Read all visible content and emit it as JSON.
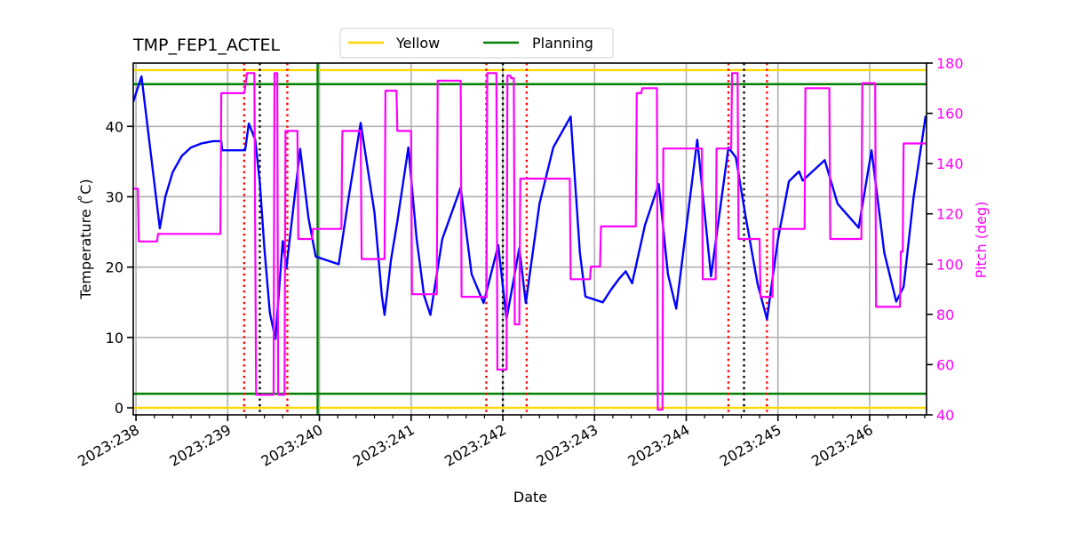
{
  "chart_data": {
    "type": "line",
    "title": "TMP_FEP1_ACTEL",
    "xlabel": "Date",
    "ylabel": "Temperature ($^\\circ$C)",
    "ylabel_display": "Temperature ( ̊C)",
    "y2label": "Pitch (deg)",
    "xlim": [
      237.97,
      246.62
    ],
    "ylim": [
      -1,
      49
    ],
    "y2lim": [
      40,
      180
    ],
    "grid": true,
    "legend_position": "top-center, above plot",
    "x_ticks": [
      238,
      239,
      240,
      241,
      242,
      243,
      244,
      245,
      246
    ],
    "x_tick_labels": [
      "2023:238",
      "2023:239",
      "2023:240",
      "2023:241",
      "2023:242",
      "2023:243",
      "2023:244",
      "2023:245",
      "2023:246"
    ],
    "x_minor_step": 0.2,
    "y_ticks": [
      0,
      10,
      20,
      30,
      40
    ],
    "y2_ticks": [
      40,
      60,
      80,
      100,
      120,
      140,
      160,
      180
    ],
    "colors": {
      "temperature": "#0000ff",
      "pitch": "#ff00ff",
      "yellow_limit": "#ffd700",
      "planning_limit": "#008000",
      "grid": "#b0b0b0",
      "comm_marker": "#ff0000",
      "pass_marker": "#000000",
      "pitch_axis": "#ff00ff"
    },
    "legend": [
      {
        "label": "Yellow",
        "color": "#ffd700"
      },
      {
        "label": "Planning",
        "color": "#008000"
      }
    ],
    "limits": {
      "yellow": [
        0,
        48
      ],
      "planning": [
        2,
        46
      ]
    },
    "vertical_lines": {
      "planning_start": 239.98,
      "red_dotted": [
        239.18,
        239.65,
        241.82,
        242.26,
        244.46,
        244.88
      ],
      "black_dotted": [
        239.35,
        242.0,
        244.63
      ]
    },
    "series": [
      {
        "name": "Temperature",
        "axis": "left",
        "x": [
          237.97,
          238.06,
          238.26,
          238.32,
          238.4,
          238.5,
          238.6,
          238.72,
          238.84,
          238.93,
          238.94,
          239.19,
          239.23,
          239.3,
          239.35,
          239.4,
          239.46,
          239.52,
          239.6,
          239.64,
          239.79,
          239.88,
          239.96,
          240.21,
          240.32,
          240.45,
          240.6,
          240.68,
          240.71,
          240.78,
          240.85,
          240.97,
          241.06,
          241.14,
          241.21,
          241.34,
          241.54,
          241.66,
          241.79,
          241.95,
          242.04,
          242.18,
          242.25,
          242.4,
          242.55,
          242.74,
          242.84,
          242.9,
          243.09,
          243.18,
          243.27,
          243.34,
          243.41,
          243.55,
          243.7,
          243.8,
          243.89,
          244.12,
          244.27,
          244.46,
          244.54,
          244.65,
          244.78,
          244.88,
          245.0,
          245.12,
          245.23,
          245.27,
          245.51,
          245.65,
          245.88,
          246.02,
          246.16,
          246.29,
          246.37,
          246.48,
          246.61
        ],
        "values": [
          43.5,
          47.1,
          25.5,
          30.0,
          33.5,
          35.8,
          37.0,
          37.6,
          37.9,
          37.9,
          36.6,
          36.6,
          40.4,
          38.1,
          32.0,
          22.7,
          13.5,
          9.8,
          23.7,
          19.9,
          36.8,
          27.0,
          21.5,
          20.4,
          30.0,
          40.5,
          27.8,
          16.0,
          13.2,
          21.0,
          26.5,
          37.0,
          24.0,
          16.0,
          13.2,
          24.0,
          31.3,
          19.0,
          14.9,
          23.1,
          12.6,
          22.7,
          14.9,
          29.0,
          37.0,
          41.4,
          22.0,
          15.8,
          15.0,
          16.8,
          18.4,
          19.4,
          17.7,
          26.0,
          31.8,
          19.0,
          14.1,
          38.1,
          18.7,
          37.0,
          35.6,
          27.0,
          17.5,
          12.6,
          24.0,
          32.2,
          33.6,
          32.3,
          35.2,
          29.0,
          25.6,
          36.6,
          22.0,
          15.1,
          17.2,
          30.0,
          41.5
        ]
      },
      {
        "name": "Pitch",
        "axis": "right",
        "x": [
          237.97,
          238.02,
          238.03,
          238.23,
          238.24,
          238.92,
          238.93,
          239.18,
          239.19,
          239.21,
          239.23,
          239.29,
          239.31,
          239.5,
          239.51,
          239.54,
          239.55,
          239.62,
          239.63,
          239.65,
          239.67,
          239.76,
          239.77,
          239.92,
          239.93,
          240.02,
          240.03,
          240.24,
          240.25,
          240.45,
          240.46,
          240.71,
          240.72,
          240.84,
          240.85,
          240.94,
          240.95,
          241.0,
          241.01,
          241.28,
          241.29,
          241.54,
          241.55,
          241.82,
          241.83,
          241.93,
          241.94,
          242.04,
          242.05,
          242.08,
          242.09,
          242.12,
          242.13,
          242.18,
          242.19,
          242.24,
          242.25,
          242.73,
          242.74,
          242.95,
          242.96,
          243.06,
          243.07,
          243.45,
          243.46,
          243.51,
          243.52,
          243.68,
          243.69,
          243.74,
          243.75,
          243.94,
          243.95,
          244.17,
          244.18,
          244.32,
          244.33,
          244.49,
          244.5,
          244.56,
          244.57,
          244.8,
          244.81,
          244.94,
          244.95,
          245.29,
          245.3,
          245.56,
          245.57,
          245.91,
          245.92,
          246.06,
          246.07,
          246.33,
          246.34,
          246.36,
          246.37,
          246.61
        ],
        "values": [
          130,
          130,
          109,
          109,
          112,
          112,
          168,
          168,
          170,
          176,
          176,
          176,
          48,
          48,
          176,
          176,
          48,
          48,
          153,
          153,
          153,
          153,
          110,
          110,
          114,
          114,
          114,
          114,
          153,
          153,
          102,
          102,
          169,
          169,
          153,
          153,
          153,
          153,
          88,
          88,
          173,
          173,
          87,
          87,
          176,
          176,
          58,
          58,
          175,
          175,
          174,
          174,
          76,
          76,
          134,
          134,
          134,
          134,
          94,
          94,
          99,
          99,
          115,
          115,
          168,
          168,
          170,
          170,
          42,
          42,
          146,
          146,
          146,
          146,
          94,
          94,
          146,
          146,
          176,
          176,
          110,
          110,
          87,
          87,
          114,
          114,
          170,
          170,
          110,
          110,
          172,
          172,
          83,
          83,
          105,
          105,
          148,
          148
        ]
      }
    ]
  }
}
